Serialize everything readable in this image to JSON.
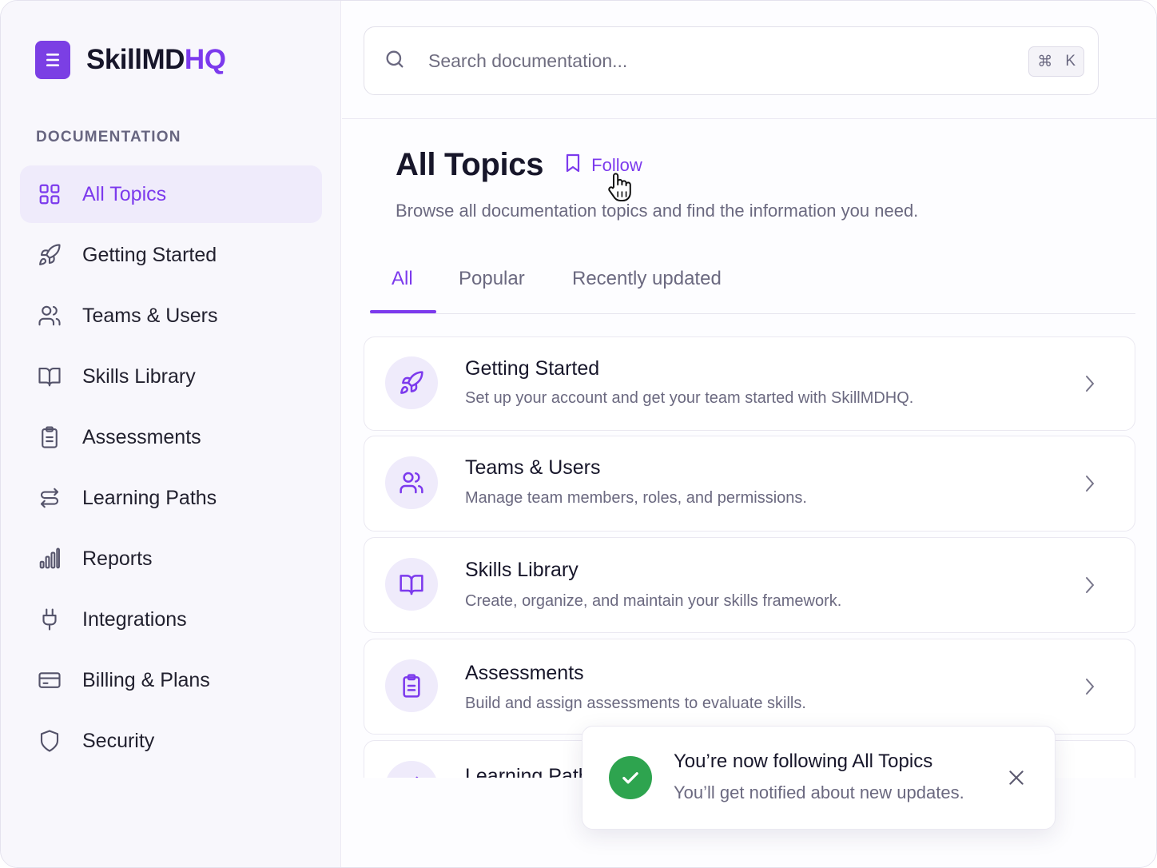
{
  "brand": {
    "name_main": "SkillMD",
    "name_accent": "HQ"
  },
  "colors": {
    "accent": "#7c3aed",
    "success": "#2ea44f",
    "sidebar_bg": "#f8f7fc"
  },
  "sidebar": {
    "section_label": "DOCUMENTATION",
    "items": [
      {
        "label": "All Topics",
        "icon": "grid-icon",
        "active": true
      },
      {
        "label": "Getting Started",
        "icon": "rocket-icon"
      },
      {
        "label": "Teams & Users",
        "icon": "users-icon"
      },
      {
        "label": "Skills Library",
        "icon": "book-icon"
      },
      {
        "label": "Assessments",
        "icon": "clipboard-icon"
      },
      {
        "label": "Learning Paths",
        "icon": "route-icon"
      },
      {
        "label": "Reports",
        "icon": "bar-chart-icon"
      },
      {
        "label": "Integrations",
        "icon": "plug-icon"
      },
      {
        "label": "Billing & Plans",
        "icon": "credit-card-icon"
      },
      {
        "label": "Security",
        "icon": "shield-icon"
      }
    ]
  },
  "search": {
    "placeholder": "Search documentation...",
    "shortcut_symbol": "⌘",
    "shortcut_key": "K"
  },
  "header": {
    "title": "All Topics",
    "follow_label": "Follow",
    "subtitle": "Browse all documentation topics and find the information you need."
  },
  "tabs": [
    {
      "label": "All",
      "active": true
    },
    {
      "label": "Popular"
    },
    {
      "label": "Recently updated"
    }
  ],
  "topics": [
    {
      "title": "Getting Started",
      "description": "Set up your account and get your team started with SkillMDHQ.",
      "icon": "rocket-icon"
    },
    {
      "title": "Teams & Users",
      "description": "Manage team members, roles, and permissions.",
      "icon": "users-icon"
    },
    {
      "title": "Skills Library",
      "description": "Create, organize, and maintain your skills framework.",
      "icon": "book-icon"
    },
    {
      "title": "Assessments",
      "description": "Build and assign assessments to evaluate skills.",
      "icon": "clipboard-icon"
    },
    {
      "title": "Learning Paths",
      "description": "",
      "icon": "route-icon"
    }
  ],
  "toast": {
    "title": "You’re now following All Topics",
    "message": "You’ll get notified about new updates."
  }
}
